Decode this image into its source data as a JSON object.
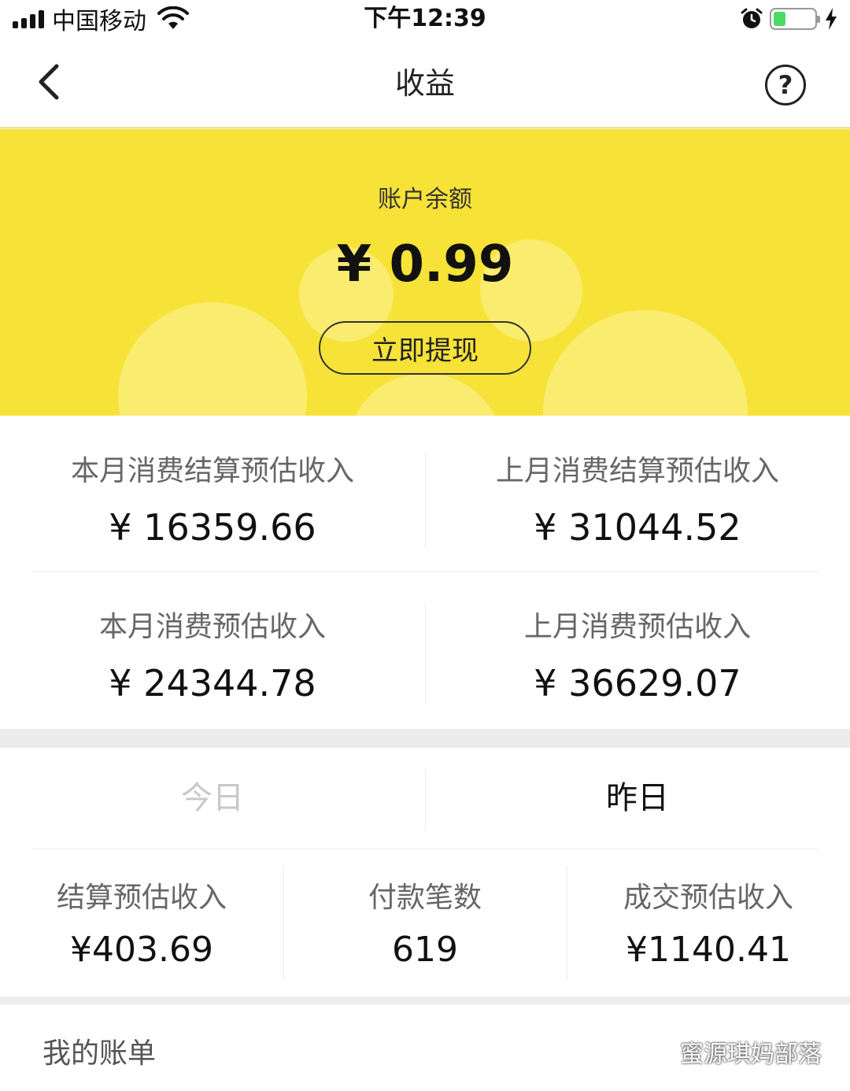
{
  "status_bar": {
    "carrier": "中国移动",
    "time": "下午12:39",
    "battery_level": 0.3
  },
  "nav": {
    "title": "收益",
    "help": "?"
  },
  "balance": {
    "label": "账户余额",
    "amount": "¥ 0.99",
    "withdraw_label": "立即提现"
  },
  "stats": [
    {
      "label": "本月消费结算预估收入",
      "value": "¥ 16359.66"
    },
    {
      "label": "上月消费结算预估收入",
      "value": "¥ 31044.52"
    },
    {
      "label": "本月消费预估收入",
      "value": "¥ 24344.78"
    },
    {
      "label": "上月消费预估收入",
      "value": "¥ 36629.07"
    }
  ],
  "tabs": {
    "today": "今日",
    "yesterday": "昨日",
    "selected": "yesterday"
  },
  "daily": [
    {
      "label": "结算预估收入",
      "value": "¥403.69"
    },
    {
      "label": "付款笔数",
      "value": "619"
    },
    {
      "label": "成交预估收入",
      "value": "¥1140.41"
    }
  ],
  "bill": {
    "label": "我的账单"
  },
  "watermark": {
    "text": "蜜源琪妈部落"
  },
  "colors": {
    "accent_yellow": "#f7e238",
    "battery_green": "#4cd964"
  }
}
